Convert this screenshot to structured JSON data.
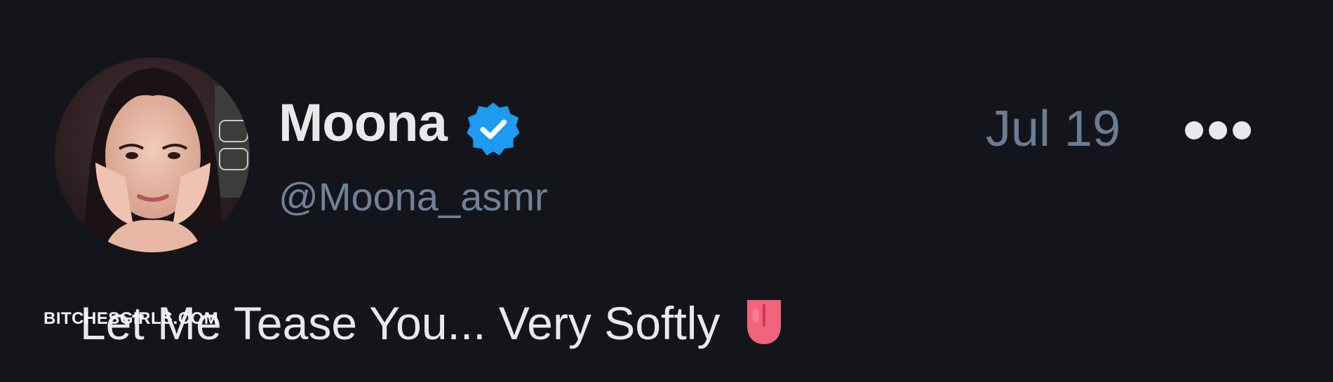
{
  "author": {
    "display_name": "Moona",
    "handle": "@Moona_asmr",
    "verified_icon": "verified-badge-icon",
    "avatar_icon": "avatar-photo"
  },
  "post": {
    "date": "Jul 19",
    "text": "Let Me Tease You... Very Softly",
    "emoji_icon": "tongue-emoji-icon"
  },
  "more_menu_icon": "more-dots-icon",
  "watermark": "BITCHESGIRLS.COM",
  "colors": {
    "background": "#14151a",
    "primary_text": "#e7e9ea",
    "secondary_text": "#71819a",
    "verified_blue": "#1d9bf0"
  }
}
